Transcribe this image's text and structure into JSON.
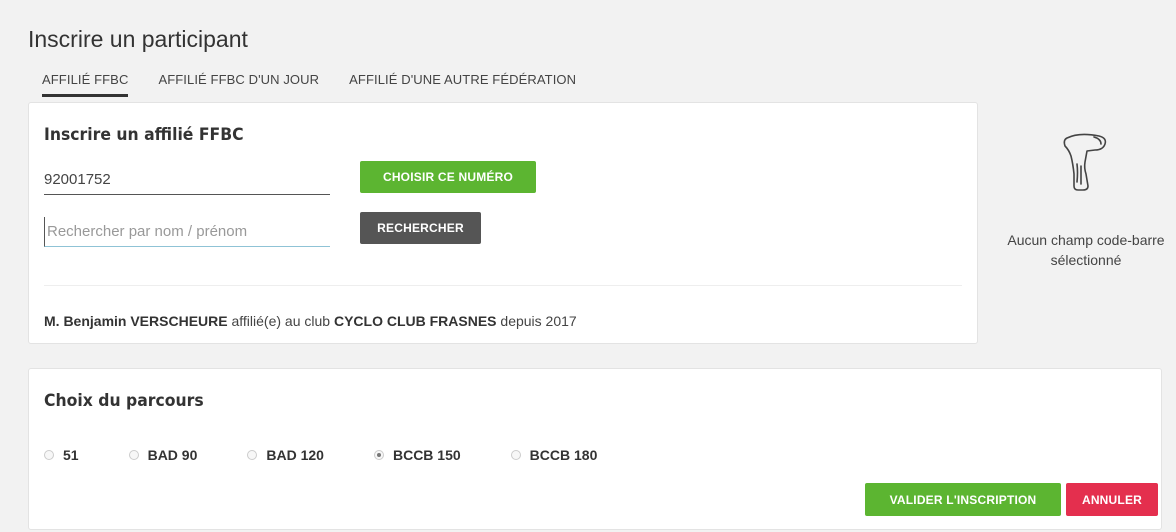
{
  "page": {
    "title": "Inscrire un participant"
  },
  "tabs": [
    {
      "label": "AFFILIÉ FFBC",
      "active": true
    },
    {
      "label": "AFFILIÉ FFBC D'UN JOUR",
      "active": false
    },
    {
      "label": "AFFILIÉ D'UNE AUTRE FÉDÉRATION",
      "active": false
    }
  ],
  "ffbc": {
    "title": "Inscrire un affilié FFBC",
    "number_value": "92001752",
    "choose_label": "CHOISIR CE NUMÉRO",
    "search_placeholder": "Rechercher par nom / prénom",
    "search_label": "RECHERCHER",
    "member": {
      "name": "M. Benjamin VERSCHEURE",
      "affiliated": "affilié(e) au club",
      "club": "CYCLO CLUB FRASNES",
      "since": "depuis 2017"
    }
  },
  "scanner": {
    "icon": "barcode-scanner-icon",
    "text": "Aucun champ code-barre sélectionné"
  },
  "parcours": {
    "title": "Choix du parcours",
    "options": [
      {
        "label": "51",
        "checked": false
      },
      {
        "label": "BAD 90",
        "checked": false
      },
      {
        "label": "BAD 120",
        "checked": false
      },
      {
        "label": "BCCB 150",
        "checked": true
      },
      {
        "label": "BCCB 180",
        "checked": false
      }
    ],
    "validate_label": "VALIDER L'INSCRIPTION",
    "cancel_label": "ANNULER"
  },
  "colors": {
    "primary_green": "#5cb531",
    "dark_button": "#555555",
    "danger_red": "#e42f4e"
  }
}
